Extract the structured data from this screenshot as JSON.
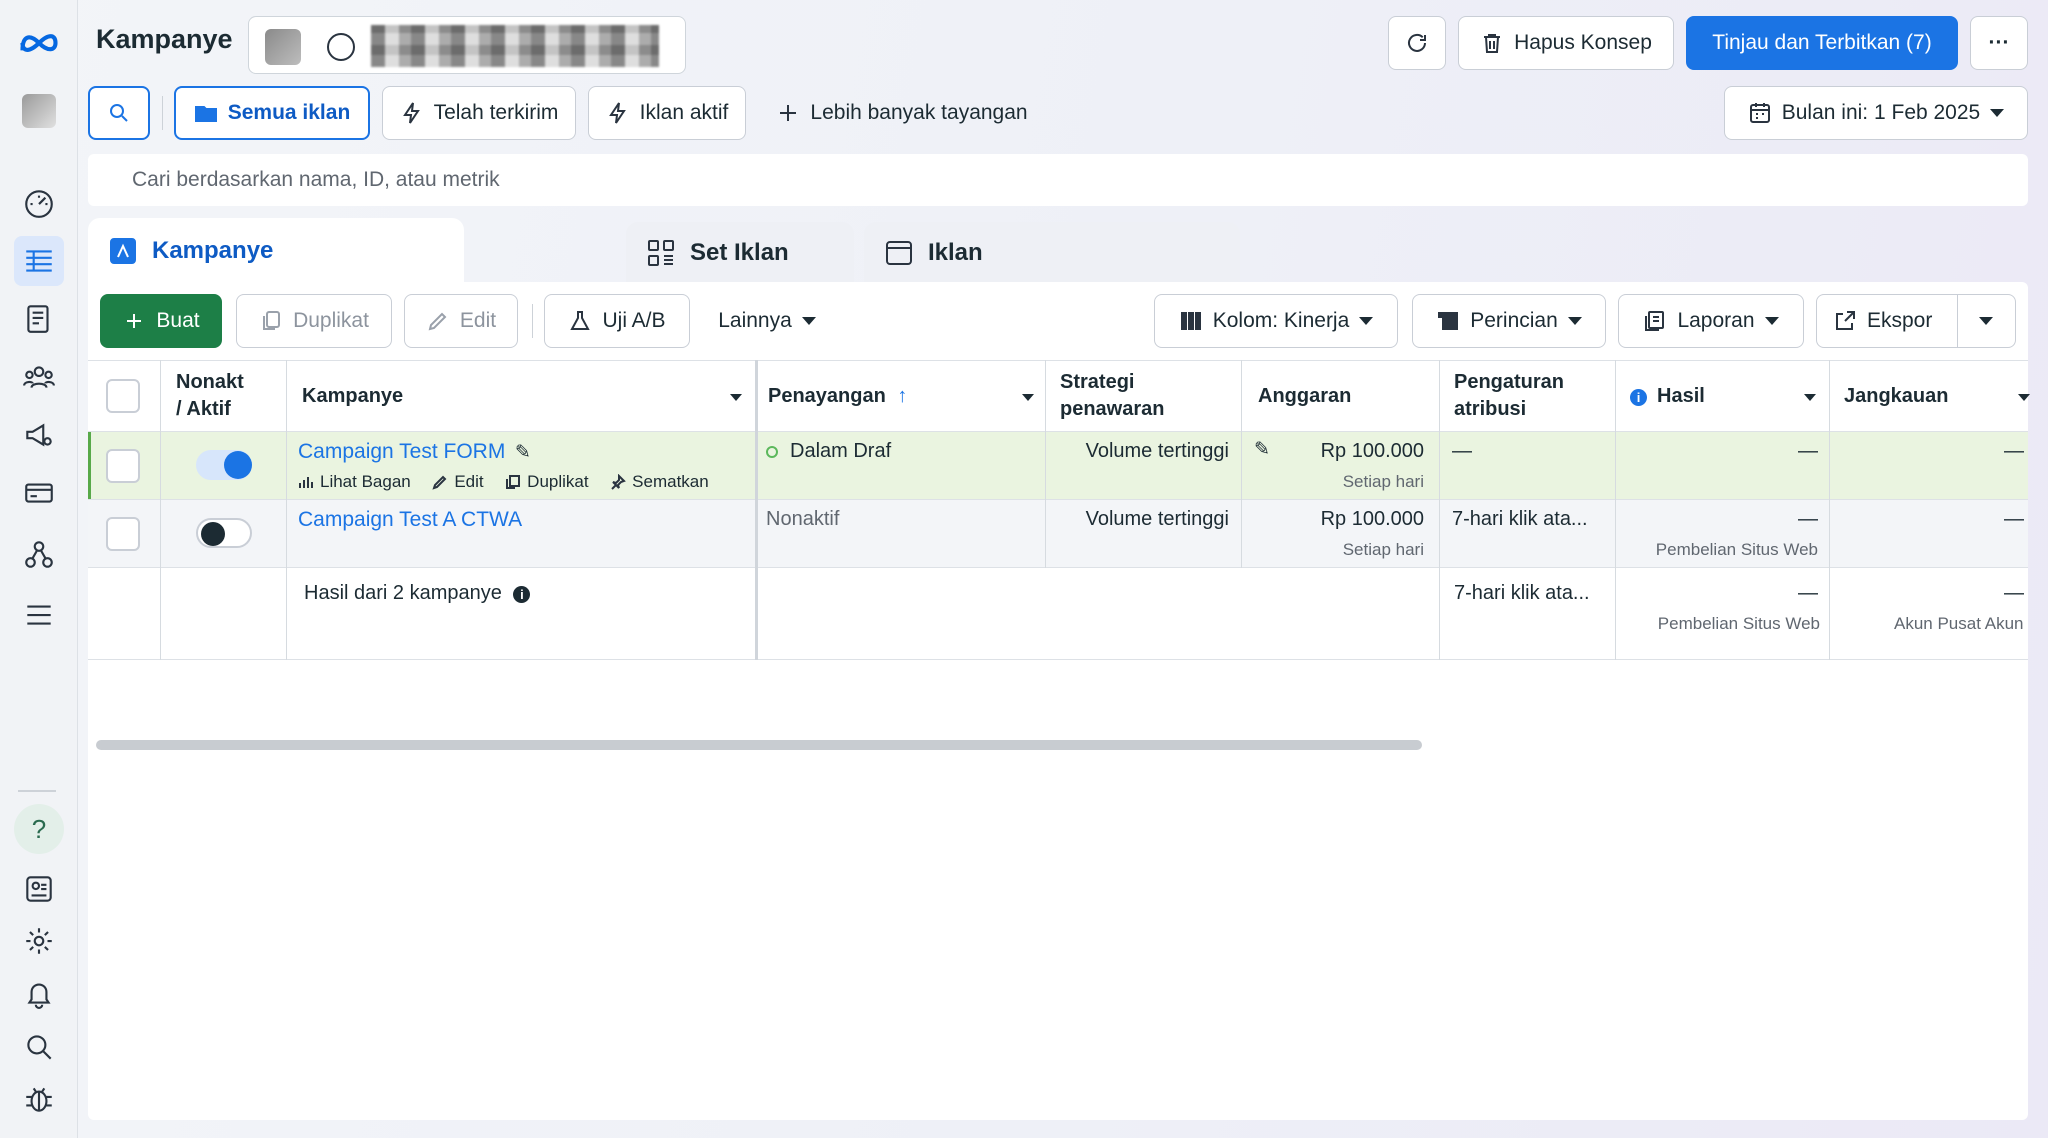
{
  "header": {
    "title": "Kampanye",
    "delete_draft": "Hapus Konsep",
    "review_publish": "Tinjau dan Terbitkan (7)",
    "more": "···"
  },
  "filters": {
    "all_ads": "Semua iklan",
    "delivered": "Telah terkirim",
    "active_ads": "Iklan aktif",
    "more_views": "Lebih banyak tayangan",
    "date_range": "Bulan ini: 1 Feb 2025"
  },
  "search": {
    "placeholder": "Cari berdasarkan nama, ID, atau metrik"
  },
  "tabs": {
    "campaigns": "Kampanye",
    "ad_sets": "Set Iklan",
    "ads": "Iklan"
  },
  "toolbar": {
    "create": "Buat",
    "duplicate": "Duplikat",
    "edit": "Edit",
    "ab_test": "Uji A/B",
    "more": "Lainnya",
    "columns": "Kolom: Kinerja",
    "breakdown": "Perincian",
    "reports": "Laporan",
    "export": "Ekspor"
  },
  "table": {
    "headers": {
      "toggle_line1": "Nonakt",
      "toggle_line2": "/ Aktif",
      "campaign": "Kampanye",
      "delivery": "Penayangan",
      "bid_line1": "Strategi",
      "bid_line2": "penawaran",
      "budget": "Anggaran",
      "attr_line1": "Pengaturan",
      "attr_line2": "atribusi",
      "results": "Hasil",
      "reach": "Jangkauan"
    },
    "rows": [
      {
        "name": "Campaign Test FORM",
        "actions": {
          "chart": "Lihat Bagan",
          "edit": "Edit",
          "duplicate": "Duplikat",
          "pin": "Sematkan"
        },
        "delivery": "Dalam Draf",
        "bid": "Volume tertinggi",
        "budget": "Rp 100.000",
        "budget_sub": "Setiap hari",
        "attribution": "—",
        "results": "—",
        "reach": "—",
        "active": true
      },
      {
        "name": "Campaign Test A CTWA",
        "delivery": "Nonaktif",
        "bid": "Volume tertinggi",
        "budget": "Rp 100.000",
        "budget_sub": "Setiap hari",
        "attribution": "7-hari klik ata...",
        "results": "—",
        "results_sub": "Pembelian Situs Web",
        "reach": "—",
        "active": false
      }
    ],
    "summary": {
      "label": "Hasil dari 2 kampanye",
      "attribution": "7-hari klik ata...",
      "results": "—",
      "results_sub": "Pembelian Situs Web",
      "reach": "—",
      "reach_sub": "Akun Pusat Akun"
    }
  },
  "colors": {
    "accent": "#1b74e4",
    "create": "#1d7f47",
    "draft_row": "#eaf4e0"
  }
}
